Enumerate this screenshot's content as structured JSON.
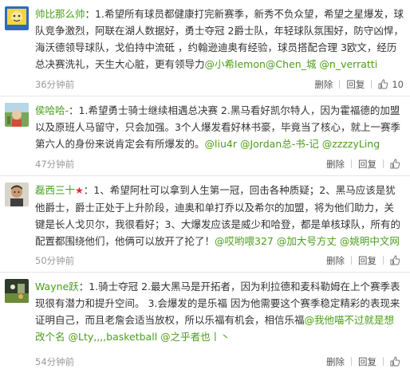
{
  "comments": [
    {
      "username": "帅比那么帅",
      "badge": "",
      "text": "：1.希望所有球员都健康打完新赛季，新秀不负众望，希望之星爆发，球队竞争激烈，阿联在湖人数据好，勇士夺冠   2爵士队，年轻球队氛围好，防守凶悍，海沃德领导球队，戈伯持中流砥   ，约翰逊迪奥有经验，球员搭配合理   3欧文，经历总决赛洗礼，天生大心脏，更有领导力",
      "mentions": "@小希lemon@Chen_城 @n_verratti",
      "time": "36分钟前",
      "delete_label": "删除",
      "reply_label": "回复",
      "like_count": "10"
    },
    {
      "username": "侯哈哈-",
      "badge": "",
      "text": "：1.希望勇士骑士继续相遇总决赛 2.黑马看好凯尔特人，因为霍福德的加盟以及原班人马留守，只会加强。3个人爆发看好林书豪，毕竟当了核心，就上一赛季第六人的身份来说肯定会有所爆发的。",
      "mentions": "@liu4r @Jordan总-书-记 @zzzzyLing",
      "time": "47分钟前",
      "delete_label": "删除",
      "reply_label": "回复",
      "like_count": ""
    },
    {
      "username": "磊西三十",
      "badge": "★",
      "text": "：1、希望阿杜可以拿到人生第一冠，回击各种质疑；2、黑马应该是犹他爵士，爵士正处于上升阶段，迪奥和单打乔以及希尔的加盟，将为他们助力，关键是长人戈贝尔，我很看好；3、大爆发应该是威少和哈登，都是单核球队，所有的配置都围绕他们，他俩可以放开了抡了！",
      "mentions": "@哎哟喂327 @加大号方丈 @姚明中文网",
      "time": "50分钟前",
      "delete_label": "删除",
      "reply_label": "回复",
      "like_count": ""
    },
    {
      "username": "Wayne跃",
      "badge": "",
      "text": "：1.骑士夺冠 2.最大黑马是开拓者，因为利拉德和麦科勒姆在上个赛季表现很有潜力和提升空间。 3.会爆发的是乐福 因为他需要这个赛季稳定精彩的表现来证明自己，而且老詹会适当放权，所以乐福有机会，相信乐福",
      "mentions": "@我他喵不过就是想改个名 @Lty,,,,basketball @之乎者也丨丶",
      "time": "54分钟前",
      "delete_label": "删除",
      "reply_label": "回复",
      "like_count": ""
    }
  ]
}
